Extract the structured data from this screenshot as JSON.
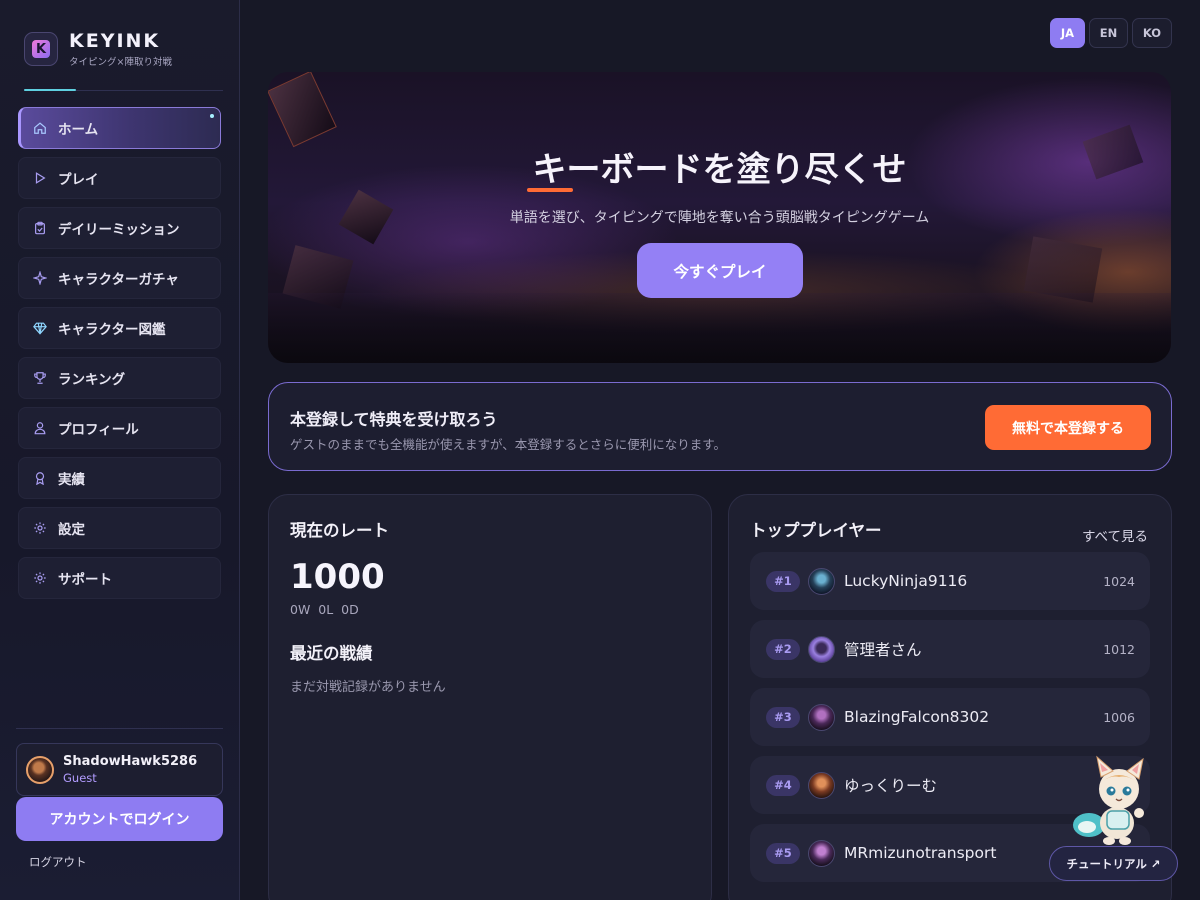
{
  "brand": {
    "name": "KEYINK",
    "tagline": "タイピング×陣取り対戦",
    "logo_letter": "K"
  },
  "sidebar": {
    "items": [
      {
        "label": "ホーム",
        "icon": "home-icon",
        "active": true
      },
      {
        "label": "プレイ",
        "icon": "play-icon"
      },
      {
        "label": "デイリーミッション",
        "icon": "clipboard-icon"
      },
      {
        "label": "キャラクターガチャ",
        "icon": "sparkle-icon"
      },
      {
        "label": "キャラクター図鑑",
        "icon": "gem-icon"
      },
      {
        "label": "ランキング",
        "icon": "trophy-icon"
      },
      {
        "label": "プロフィール",
        "icon": "user-icon"
      },
      {
        "label": "実績",
        "icon": "award-icon"
      },
      {
        "label": "設定",
        "icon": "gear-icon"
      },
      {
        "label": "サポート",
        "icon": "gear-icon"
      }
    ]
  },
  "user": {
    "name": "ShadowHawk5286",
    "role": "Guest",
    "login_label": "アカウントでログイン",
    "logout_label": "ログアウト"
  },
  "languages": [
    {
      "code": "JA",
      "active": true
    },
    {
      "code": "EN"
    },
    {
      "code": "KO"
    }
  ],
  "hero": {
    "title": "キーボードを塗り尽くせ",
    "subtitle": "単語を選び、タイピングで陣地を奪い合う頭脳戦タイピングゲーム",
    "cta": "今すぐプレイ"
  },
  "register": {
    "title": "本登録して特典を受け取ろう",
    "subtitle": "ゲストのままでも全機能が使えますが、本登録するとさらに便利になります。",
    "cta": "無料で本登録する"
  },
  "rate": {
    "heading": "現在のレート",
    "value": "1000",
    "record": "0W 0L 0D",
    "recent_heading": "最近の戦績",
    "recent_empty": "まだ対戦記録がありません"
  },
  "top_players": {
    "heading": "トッププレイヤー",
    "see_all": "すべて見る",
    "players": [
      {
        "rank": "#1",
        "name": "LuckyNinja9116",
        "score": "1024"
      },
      {
        "rank": "#2",
        "name": "管理者さん",
        "score": "1012"
      },
      {
        "rank": "#3",
        "name": "BlazingFalcon8302",
        "score": "1006"
      },
      {
        "rank": "#4",
        "name": "ゆっくりーむ",
        "score": ""
      },
      {
        "rank": "#5",
        "name": "MRmizunotransport",
        "score": ""
      }
    ]
  },
  "tutorial": {
    "label": "チュートリアル ↗"
  },
  "colors": {
    "accent": "#8e7cf2",
    "orange": "#ff6b35",
    "bg": "#171826"
  }
}
